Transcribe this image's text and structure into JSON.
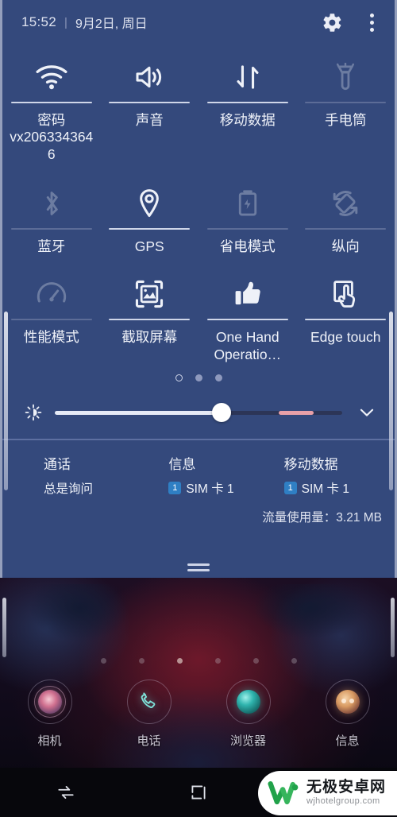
{
  "status_bar": {
    "time": "15:52",
    "separator": "|",
    "date": "9月2日, 周日",
    "gear_icon": "gear-icon",
    "overflow_icon": "more-vertical-icon"
  },
  "quick_settings": {
    "rows": [
      [
        {
          "icon": "wifi-icon",
          "label": "密码vx2063343646",
          "state": "on"
        },
        {
          "icon": "sound-icon",
          "label": "声音",
          "state": "on"
        },
        {
          "icon": "mobile-data-icon",
          "label": "移动数据",
          "state": "on"
        },
        {
          "icon": "flashlight-icon",
          "label": "手电筒",
          "state": "off"
        }
      ],
      [
        {
          "icon": "bluetooth-icon",
          "label": "蓝牙",
          "state": "off"
        },
        {
          "icon": "location-pin-icon",
          "label": "GPS",
          "state": "on"
        },
        {
          "icon": "battery-saver-icon",
          "label": "省电模式",
          "state": "off"
        },
        {
          "icon": "rotate-icon",
          "label": "纵向",
          "state": "off"
        }
      ],
      [
        {
          "icon": "speedometer-icon",
          "label": "性能模式",
          "state": "off"
        },
        {
          "icon": "screenshot-icon",
          "label": "截取屏幕",
          "state": "on"
        },
        {
          "icon": "thumbs-up-icon",
          "label": "One Hand Operatio…",
          "state": "on"
        },
        {
          "icon": "edge-touch-icon",
          "label": "Edge touch",
          "state": "on"
        }
      ]
    ],
    "page_dots": {
      "count": 3,
      "current_index": 0
    }
  },
  "brightness": {
    "icon": "brightness-icon",
    "value_percent": 58,
    "warm_segment_start_percent": 78,
    "warm_segment_end_percent": 90,
    "chevron_icon": "chevron-down-icon"
  },
  "sim_info": {
    "columns": [
      {
        "title": "通话",
        "value": "总是询问",
        "badge": null
      },
      {
        "title": "信息",
        "value": "SIM 卡 1",
        "badge": "1"
      },
      {
        "title": "移动数据",
        "value": "SIM 卡 1",
        "badge": "1"
      }
    ],
    "data_usage": "流量使用量：3.21 MB"
  },
  "home_screen": {
    "page_dots": {
      "count": 6,
      "current_index": 2
    },
    "dock": [
      {
        "icon": "camera-icon",
        "label": "相机"
      },
      {
        "icon": "phone-icon",
        "label": "电话"
      },
      {
        "icon": "browser-icon",
        "label": "浏览器"
      },
      {
        "icon": "messages-icon",
        "label": "信息"
      }
    ]
  },
  "nav_bar": {
    "recents_icon": "recents-icon",
    "home_icon": "home-square-icon"
  },
  "watermark": {
    "logo": "w-logo-icon",
    "title": "无极安卓网",
    "subtitle": "wjhotelgroup.com"
  },
  "colors": {
    "panel_background": "#34497c",
    "panel_text": "#eef1f8",
    "sim_badge": "#2f7fc4",
    "slider_warm": "#e8a0a8",
    "navbar": "#07070c",
    "watermark_green": "#21a24a"
  }
}
